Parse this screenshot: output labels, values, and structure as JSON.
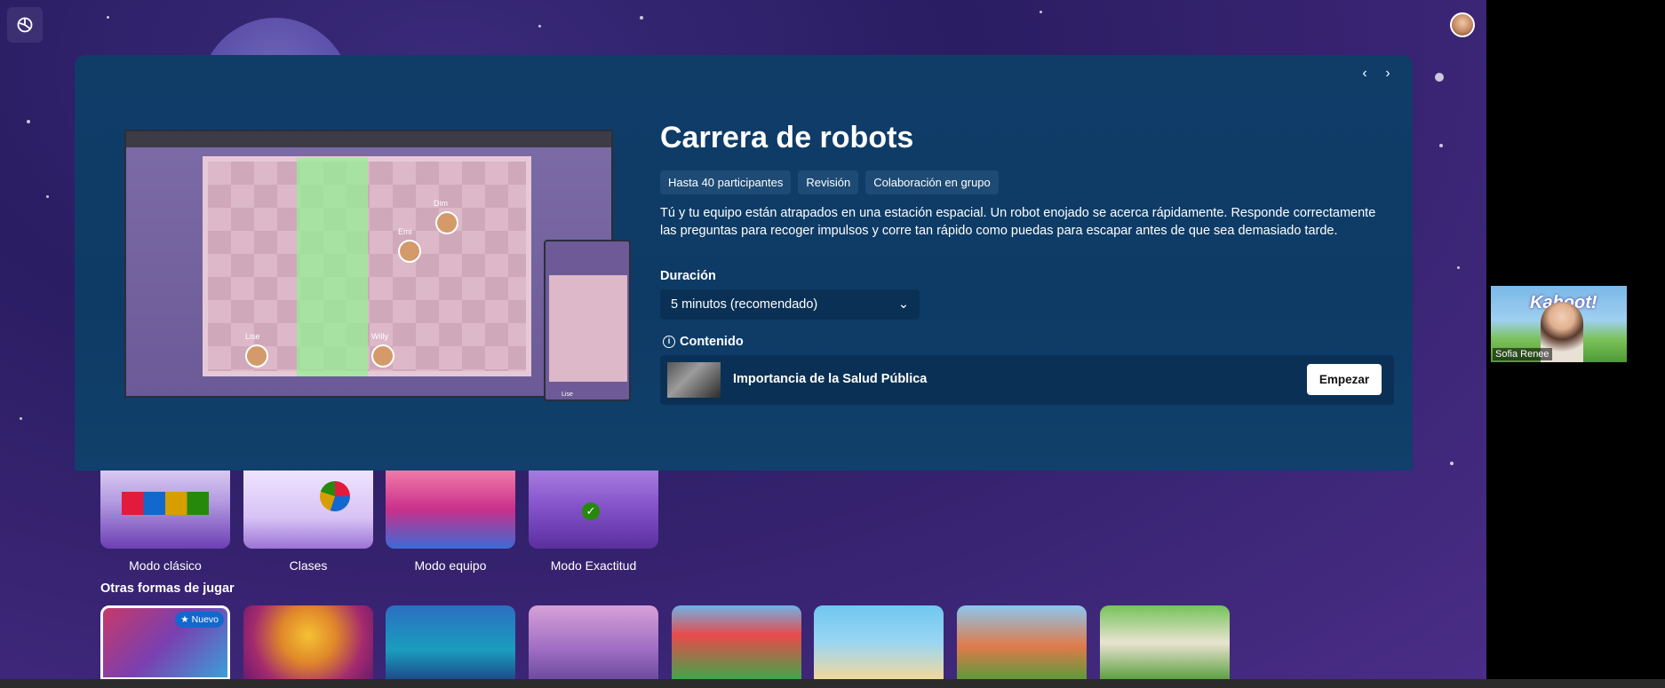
{
  "game": {
    "title": "Carrera de robots",
    "tags": [
      "Hasta 40 participantes",
      "Revisión",
      "Colaboración en grupo"
    ],
    "description": "Tú y tu equipo están atrapados en una estación espacial. Un robot enojado se acerca rápidamente. Responde correctamente las preguntas para recoger impulsos y corre tan rápido como puedas para escapar antes de que sea demasiado tarde.",
    "duration_label": "Duración",
    "duration_value": "5 minutos (recomendado)",
    "content_label": "Contenido",
    "content_title": "Importancia de la Salud Pública",
    "start_label": "Empezar"
  },
  "preview": {
    "players": [
      "Dim",
      "Emi",
      "Lise",
      "Willy"
    ],
    "phone_player": "Lise"
  },
  "modes": [
    "Modo clásico",
    "Clases",
    "Modo equipo",
    "Modo Exactitud"
  ],
  "other_section_title": "Otras formas de jugar",
  "new_badge": "Nuevo",
  "video": {
    "participant_name": "Sofia Renee",
    "logo_text": "Kahoot!"
  },
  "colors": {
    "panel": "#0f3d68",
    "background": "#2a1d63",
    "accent": "#1368ce"
  }
}
